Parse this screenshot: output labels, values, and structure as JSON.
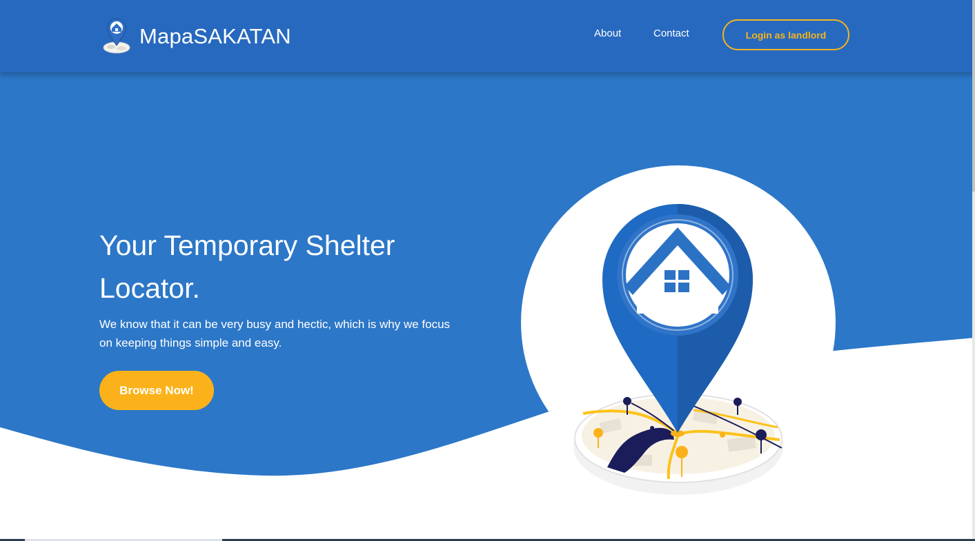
{
  "nav": {
    "brand": "MapaSAKATAN",
    "links": [
      {
        "label": "About"
      },
      {
        "label": "Contact"
      }
    ],
    "login_label": "Login as landlord"
  },
  "hero": {
    "title": "Your Temporary Shelter Locator.",
    "subtitle": "We know that it can be very busy and hectic, which is why we focus on keeping things simple and easy.",
    "cta_label": "Browse Now!"
  },
  "icons": {
    "logo": "house-pin-logo-icon",
    "illustration": "house-location-pin-on-map-icon"
  },
  "colors": {
    "nav_bg": "#2769BE",
    "hero_bg": "#2C77C7",
    "accent": "#FBB21A",
    "login_outline": "#F6B51E",
    "pin_dark": "#1F5FAE",
    "map_dark": "#1B1D5A"
  }
}
